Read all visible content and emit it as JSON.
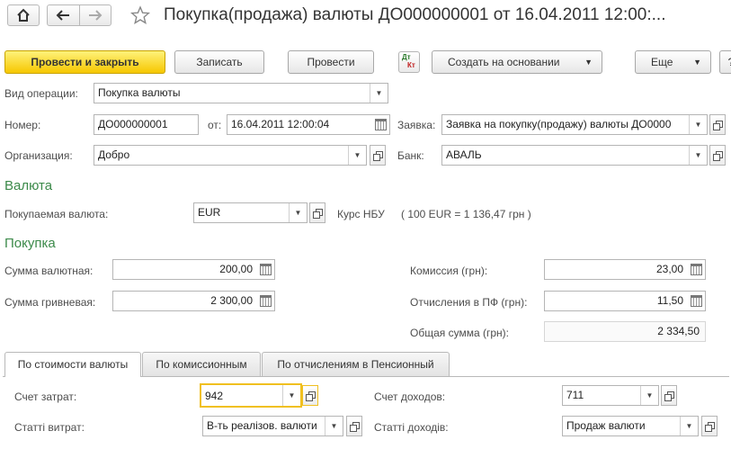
{
  "window": {
    "title": "Покупка(продажа) валюты ДО000000001 от 16.04.2011 12:00:..."
  },
  "icons": {
    "home": "home-icon",
    "back": "arrow-left-icon",
    "forward": "arrow-right-icon",
    "favorite": "star-icon",
    "dtkt": "dt-kt-icon"
  },
  "dtkt_icon": {
    "dt": "Дт",
    "kt": "Кт"
  },
  "toolbar": {
    "post_and_close": "Провести и закрыть",
    "save": "Записать",
    "post": "Провести",
    "create_based_on": "Создать на основании",
    "more": "Еще",
    "help": "?"
  },
  "header": {
    "operation_type_label": "Вид операции:",
    "operation_type_value": "Покупка валюты",
    "number_label": "Номер:",
    "number_value": "ДО000000001",
    "date_label": "от:",
    "date_value": "16.04.2011 12:00:04",
    "request_label": "Заявка:",
    "request_value": "Заявка на покупку(продажу) валюты ДО0000",
    "organization_label": "Организация:",
    "organization_value": "Добро",
    "bank_label": "Банк:",
    "bank_value": "АВАЛЬ"
  },
  "currency_section": {
    "title": "Валюта",
    "purchased_currency_label": "Покупаемая валюта:",
    "purchased_currency_value": "EUR",
    "rate_label": "Курс НБУ",
    "rate_value": "( 100 EUR = 1 136,47 грн )"
  },
  "purchase_section": {
    "title": "Покупка",
    "amount_currency_label": "Сумма валютная:",
    "amount_currency_value": "200,00",
    "amount_uah_label": "Сумма гривневая:",
    "amount_uah_value": "2 300,00",
    "commission_label": "Комиссия (грн):",
    "commission_value": "23,00",
    "pension_label": "Отчисления в ПФ (грн):",
    "pension_value": "11,50",
    "total_label": "Общая сумма (грн):",
    "total_value": "2 334,50"
  },
  "tabs": [
    {
      "label": "По стоимости валюты"
    },
    {
      "label": "По комиссионным"
    },
    {
      "label": "По отчислениям в Пенсионный"
    }
  ],
  "tab_content": {
    "expense_account_label": "Счет затрат:",
    "expense_account_value": "942",
    "income_account_label": "Счет доходов:",
    "income_account_value": "711",
    "expense_items_label": "Статті витрат:",
    "expense_items_value": "В-ть реалізов. валюти",
    "income_items_label": "Статті доходів:",
    "income_items_value": "Продаж валюти"
  }
}
